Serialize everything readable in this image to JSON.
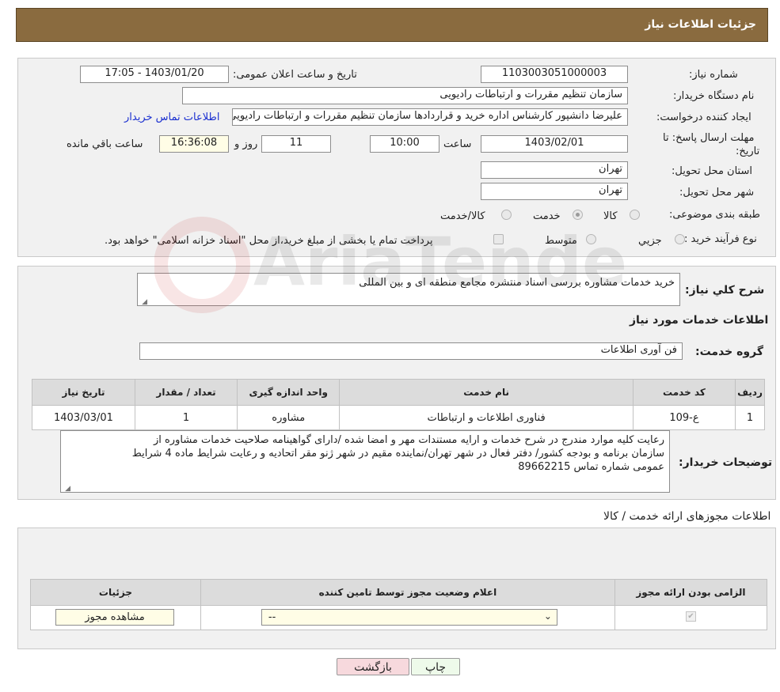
{
  "header": {
    "title": "جزئیات اطلاعات نیاز"
  },
  "form": {
    "need_number_label": "شماره نیاز:",
    "need_number": "1103003051000003",
    "announce_label": "تاریخ و ساعت اعلان عمومی:",
    "announce_value": "1403/01/20 - 17:05",
    "buyer_org_label": "نام دستگاه خریدار:",
    "buyer_org": "سازمان تنظیم مقررات و ارتباطات رادیویی",
    "creator_label": "ایجاد کننده درخواست:",
    "creator": "علیرضا دانشپور کارشناس اداره خرید و قراردادها سازمان تنظیم مقررات و ارتباطات رادیویی",
    "contact_link": "اطلاعات تماس خریدار",
    "deadline_label_1": "مهلت ارسال پاسخ: تا",
    "deadline_label_2": "تاریخ:",
    "deadline_date": "1403/02/01",
    "time_label": "ساعت",
    "deadline_time": "10:00",
    "days_value": "11",
    "days_label": "روز و",
    "remaining_time": "16:36:08",
    "remaining_label": "ساعت باقي مانده",
    "province_label": "استان محل تحویل:",
    "province": "تهران",
    "city_label": "شهر محل تحویل:",
    "city": "تهران",
    "category_label": "طبقه بندی موضوعی:",
    "category_options": [
      "کالا",
      "خدمت",
      "کالا/خدمت"
    ],
    "category_selected": "خدمت",
    "process_label": "نوع فرآیند خرید :",
    "process_options": [
      "جزيي",
      "متوسط"
    ],
    "payment_note": "پرداخت تمام یا بخشی از مبلغ خرید،از محل \"اسناد خزانه اسلامی\" خواهد بود."
  },
  "description": {
    "label": "شرح کلي نیاز:",
    "value": "خرید خدمات مشاوره بررسی اسناد منتشره مجامع منطقه ای و بین المللی"
  },
  "services": {
    "section_title": "اطلاعات خدمات مورد نیاز",
    "group_label": "گروه خدمت:",
    "group_value": "فن آوری اطلاعات",
    "columns": [
      "ردیف",
      "کد خدمت",
      "نام خدمت",
      "واحد اندازه گیری",
      "تعداد / مقدار",
      "تاریخ نیاز"
    ],
    "rows": [
      {
        "row": "1",
        "code": "ع-109",
        "name": "فناوری اطلاعات و ارتباطات",
        "unit": "مشاوره",
        "qty": "1",
        "date": "1403/03/01"
      }
    ],
    "buyer_notes_label": "توضیحات خریدار:",
    "buyer_notes_1": "رعایت کلیه موارد مندرج در شرح خدمات و ارایه مستندات مهر و امضا شده /دارای گواهینامه صلاحیت خدمات مشاوره از",
    "buyer_notes_2": "سازمان برنامه و بودجه کشور/ دفتر فعال در شهر تهران/نماینده مقیم در شهر ژنو مقر اتحادیه و رعایت شرایط ماده 4 شرایط",
    "buyer_notes_3": "عمومی شماره تماس 89662215"
  },
  "permits": {
    "title": "اطلاعات مجوزهای ارائه خدمت / کالا",
    "columns": [
      "الزامی بودن ارائه مجوز",
      "اعلام وضعیت مجوز توسط تامین کننده",
      "جزئیات"
    ],
    "select_value": "--",
    "view_button": "مشاهده مجوز"
  },
  "buttons": {
    "print": "چاپ",
    "back": "بازگشت"
  },
  "watermark": {
    "text": "AriaTender.neT"
  },
  "colors": {
    "header_bg": "#8a6b3f",
    "back_button_bg": "#f7d9dd",
    "print_button_bg": "#eefaea",
    "link": "#1a2fd0"
  }
}
